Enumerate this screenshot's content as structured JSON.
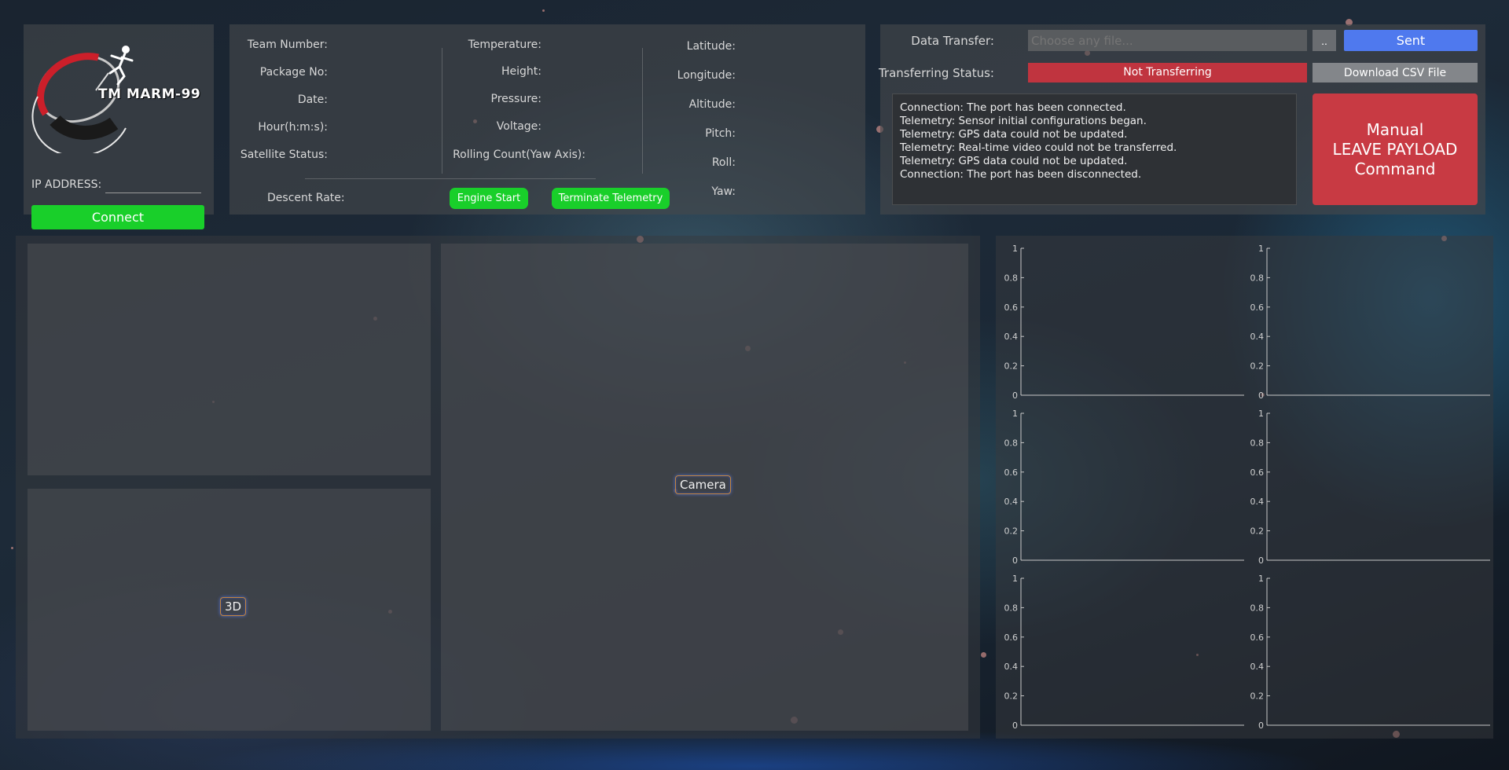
{
  "brand": {
    "logo_text": "TM MARM-99"
  },
  "connection": {
    "ip_label": "IP ADDRESS:",
    "ip_value": "",
    "connect_label": "Connect"
  },
  "telemetry": {
    "col1": [
      "Team Number:",
      "Package No:",
      "Date:",
      "Hour(h:m:s):",
      "Satellite Status:"
    ],
    "col2": [
      "Temperature:",
      "Height:",
      "Pressure:",
      "Voltage:",
      "Rolling Count(Yaw Axis):"
    ],
    "col3": [
      "Latitude:",
      "Longitude:",
      "Altitude:",
      "Pitch:",
      "Roll:",
      "Yaw:"
    ],
    "descent_rate_label": "Descent Rate:",
    "engine_start_label": "Engine Start",
    "terminate_label": "Terminate Telemetry"
  },
  "transfer": {
    "data_transfer_label": "Data Transfer:",
    "file_placeholder": "Choose any file...",
    "browse_label": "..",
    "sent_label": "Sent",
    "status_label": "Transferring Status:",
    "status_value": "Not Transferring",
    "csv_label": "Download CSV File",
    "status_color": "#c0343f"
  },
  "log": [
    "Connection: The port has been connected.",
    "Telemetry: Sensor initial configurations began.",
    "Telemetry: GPS data could not be updated.",
    "Telemetry: Real-time video could not be transferred.",
    "Telemetry: GPS data could not be updated.",
    "Connection: The port has been disconnected."
  ],
  "manual_command": [
    "Manual",
    "LEAVE PAYLOAD",
    "Command"
  ],
  "views": {
    "three_d_label": "3D",
    "camera_label": "Camera"
  },
  "chart_data": [
    {
      "type": "line",
      "series": [],
      "ylim": [
        0,
        1
      ],
      "yticks": [
        "0",
        "0.2",
        "0.4",
        "0.6",
        "0.8",
        "1"
      ]
    },
    {
      "type": "line",
      "series": [],
      "ylim": [
        0,
        1
      ],
      "yticks": [
        "0",
        "0.2",
        "0.4",
        "0.6",
        "0.8",
        "1"
      ]
    },
    {
      "type": "line",
      "series": [],
      "ylim": [
        0,
        1
      ],
      "yticks": [
        "0",
        "0.2",
        "0.4",
        "0.6",
        "0.8",
        "1"
      ]
    },
    {
      "type": "line",
      "series": [],
      "ylim": [
        0,
        1
      ],
      "yticks": [
        "0",
        "0.2",
        "0.4",
        "0.6",
        "0.8",
        "1"
      ]
    },
    {
      "type": "line",
      "series": [],
      "ylim": [
        0,
        1
      ],
      "yticks": [
        "0",
        "0.2",
        "0.4",
        "0.6",
        "0.8",
        "1"
      ]
    },
    {
      "type": "line",
      "series": [],
      "ylim": [
        0,
        1
      ],
      "yticks": [
        "0",
        "0.2",
        "0.4",
        "0.6",
        "0.8",
        "1"
      ]
    }
  ],
  "colors": {
    "connect": "#19cf2a",
    "sent": "#4f79ee",
    "manual": "#c83a43"
  }
}
